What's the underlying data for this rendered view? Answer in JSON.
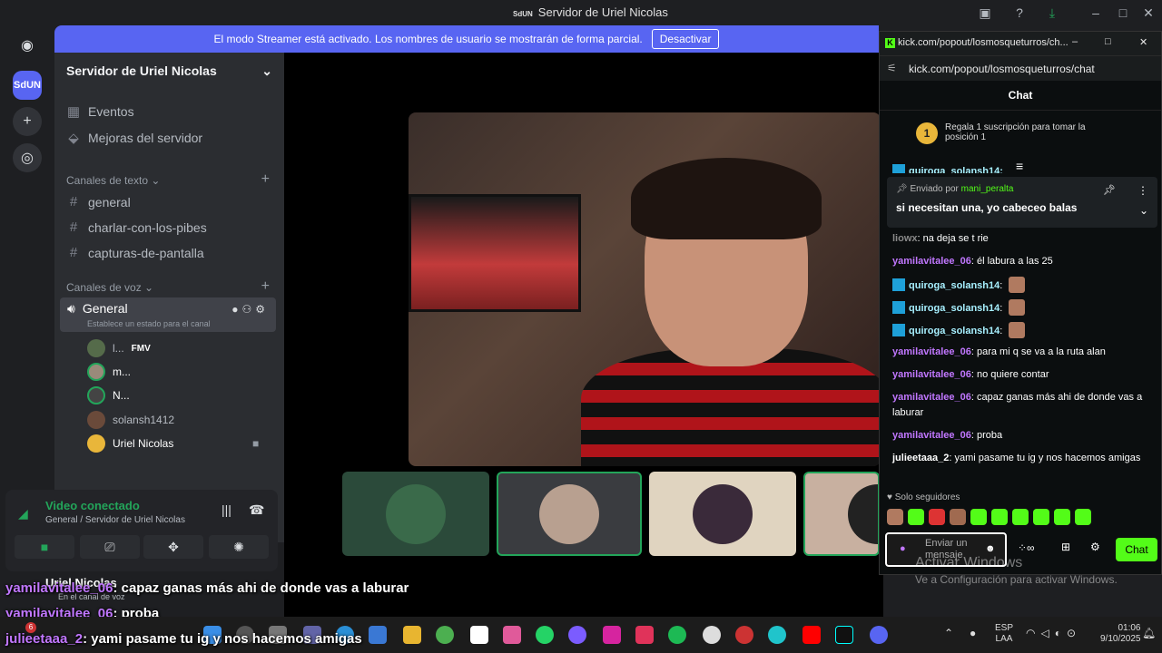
{
  "titlebar": {
    "tag": "SdUN",
    "title": "Servidor de Uriel Nicolas"
  },
  "streamer": {
    "text": "El modo Streamer está activado. Los nombres de usuario se mostrarán de forma parcial.",
    "button": "Desactivar"
  },
  "server": {
    "name": "Servidor de Uriel Nicolas",
    "icon_label": "SdUN",
    "items": [
      {
        "label": "Eventos",
        "icon": "calendar-icon"
      },
      {
        "label": "Mejoras del servidor",
        "icon": "boost-icon"
      }
    ],
    "text_category": "Canales de texto",
    "text_channels": [
      "general",
      "charlar-con-los-pibes",
      "capturas-de-pantalla"
    ],
    "voice_category": "Canales de voz",
    "voice_channel": {
      "name": "General",
      "status": "Establece un estado para el canal"
    },
    "members": [
      {
        "name": "l...",
        "tag": "FMV"
      },
      {
        "name": "m..."
      },
      {
        "name": "N..."
      },
      {
        "name": "solansh1412"
      },
      {
        "name": "Uriel Nicolas"
      }
    ]
  },
  "voice_panel": {
    "title": "Video conectado",
    "subtitle": "General / Servidor de Uriel Nicolas"
  },
  "user_panel": {
    "name": "Uriel Nicolas",
    "status": "En el canal de voz"
  },
  "chat": {
    "tab_title": "kick.com/popout/losmosqueturros/ch...",
    "url": "kick.com/popout/losmosqueturros/chat",
    "header": "Chat",
    "gift_count": "1",
    "gift_text": "Regala 1 suscripción para tomar la posición 1",
    "top_partial_user": "quiroga_solansh14:",
    "pinned_by_label": "Enviado por",
    "pinned_user": "mani_peralta",
    "pinned_msg": "si necesitan una, yo cabeceo balas",
    "messages": [
      {
        "user": "liowx",
        "text": "na deja se t rie",
        "style": "u-muted"
      },
      {
        "user": "yamilavitalee_06",
        "text": "él labura a las 25",
        "style": "u-purple"
      },
      {
        "user": "quiroga_solansh14",
        "text": "",
        "style": "u-blue",
        "emote": true
      },
      {
        "user": "quiroga_solansh14",
        "text": "",
        "style": "u-blue",
        "emote": true
      },
      {
        "user": "quiroga_solansh14",
        "text": "",
        "style": "u-blue",
        "emote": true
      },
      {
        "user": "yamilavitalee_06",
        "text": "para mi q se va a la ruta alan",
        "style": "u-purple"
      },
      {
        "user": "yamilavitalee_06",
        "text": "no quiere contar",
        "style": "u-purple"
      },
      {
        "user": "yamilavitalee_06",
        "text": "capaz ganas más ahi de donde vas a laburar",
        "style": "u-purple"
      },
      {
        "user": "yamilavitalee_06",
        "text": "proba",
        "style": "u-purple"
      },
      {
        "user": "julieetaaa_2",
        "text": "yami pasame tu ig y nos hacemos amigas",
        "style": "u-white"
      }
    ],
    "followers_only": "Solo seguidores",
    "input_placeholder": "Enviar un mensaje",
    "send": "Chat"
  },
  "activate": {
    "title": "Activar Windows",
    "subtitle": "Ve a Configuración para activar Windows."
  },
  "overlay": [
    {
      "user": "yamilavitalee_06",
      "text": ": capaz ganas más ahi de donde vas a laburar"
    },
    {
      "user": "yamilavitalee_06",
      "text": ": proba"
    },
    {
      "user": "julieetaaa_2",
      "text": ": yami pasame tu ig y nos hacemos amigas"
    }
  ],
  "taskbar": {
    "lang": "ESP",
    "layout": "LAA",
    "time": "01:06",
    "date": "9/10/2025",
    "badge": "6"
  }
}
